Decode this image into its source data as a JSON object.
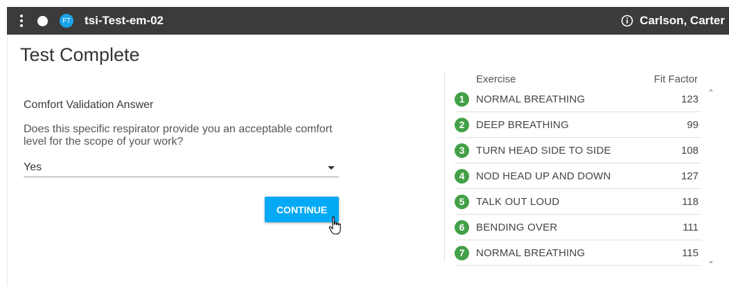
{
  "header": {
    "badge": "FT",
    "device_name": "tsi-Test-em-02",
    "user_name": "Carlson, Carter"
  },
  "main": {
    "title": "Test Complete",
    "section_label": "Comfort Validation Answer",
    "question": "Does this specific respirator provide you an acceptable comfort level for the scope of your work?",
    "answer": "Yes",
    "continue_label": "CONTINUE"
  },
  "results": {
    "col_exercise": "Exercise",
    "col_fit_factor": "Fit Factor",
    "rows": [
      {
        "num": "1",
        "exercise": "NORMAL BREATHING",
        "fit_factor": "123"
      },
      {
        "num": "2",
        "exercise": "DEEP BREATHING",
        "fit_factor": "99"
      },
      {
        "num": "3",
        "exercise": "TURN HEAD SIDE TO SIDE",
        "fit_factor": "108"
      },
      {
        "num": "4",
        "exercise": "NOD HEAD UP AND DOWN",
        "fit_factor": "127"
      },
      {
        "num": "5",
        "exercise": "TALK OUT LOUD",
        "fit_factor": "118"
      },
      {
        "num": "6",
        "exercise": "BENDING OVER",
        "fit_factor": "111"
      },
      {
        "num": "7",
        "exercise": "NORMAL BREATHING",
        "fit_factor": "115"
      }
    ]
  },
  "icons": {
    "menu": "vertical-dots-icon",
    "status": "status-dot-icon",
    "info": "info-circle-icon",
    "cursor": "hand-pointer-icon"
  },
  "colors": {
    "topbar": "#3b3b3b",
    "accent": "#03a9f4",
    "badge": "#1aa3ea",
    "row_number": "#43a047"
  }
}
